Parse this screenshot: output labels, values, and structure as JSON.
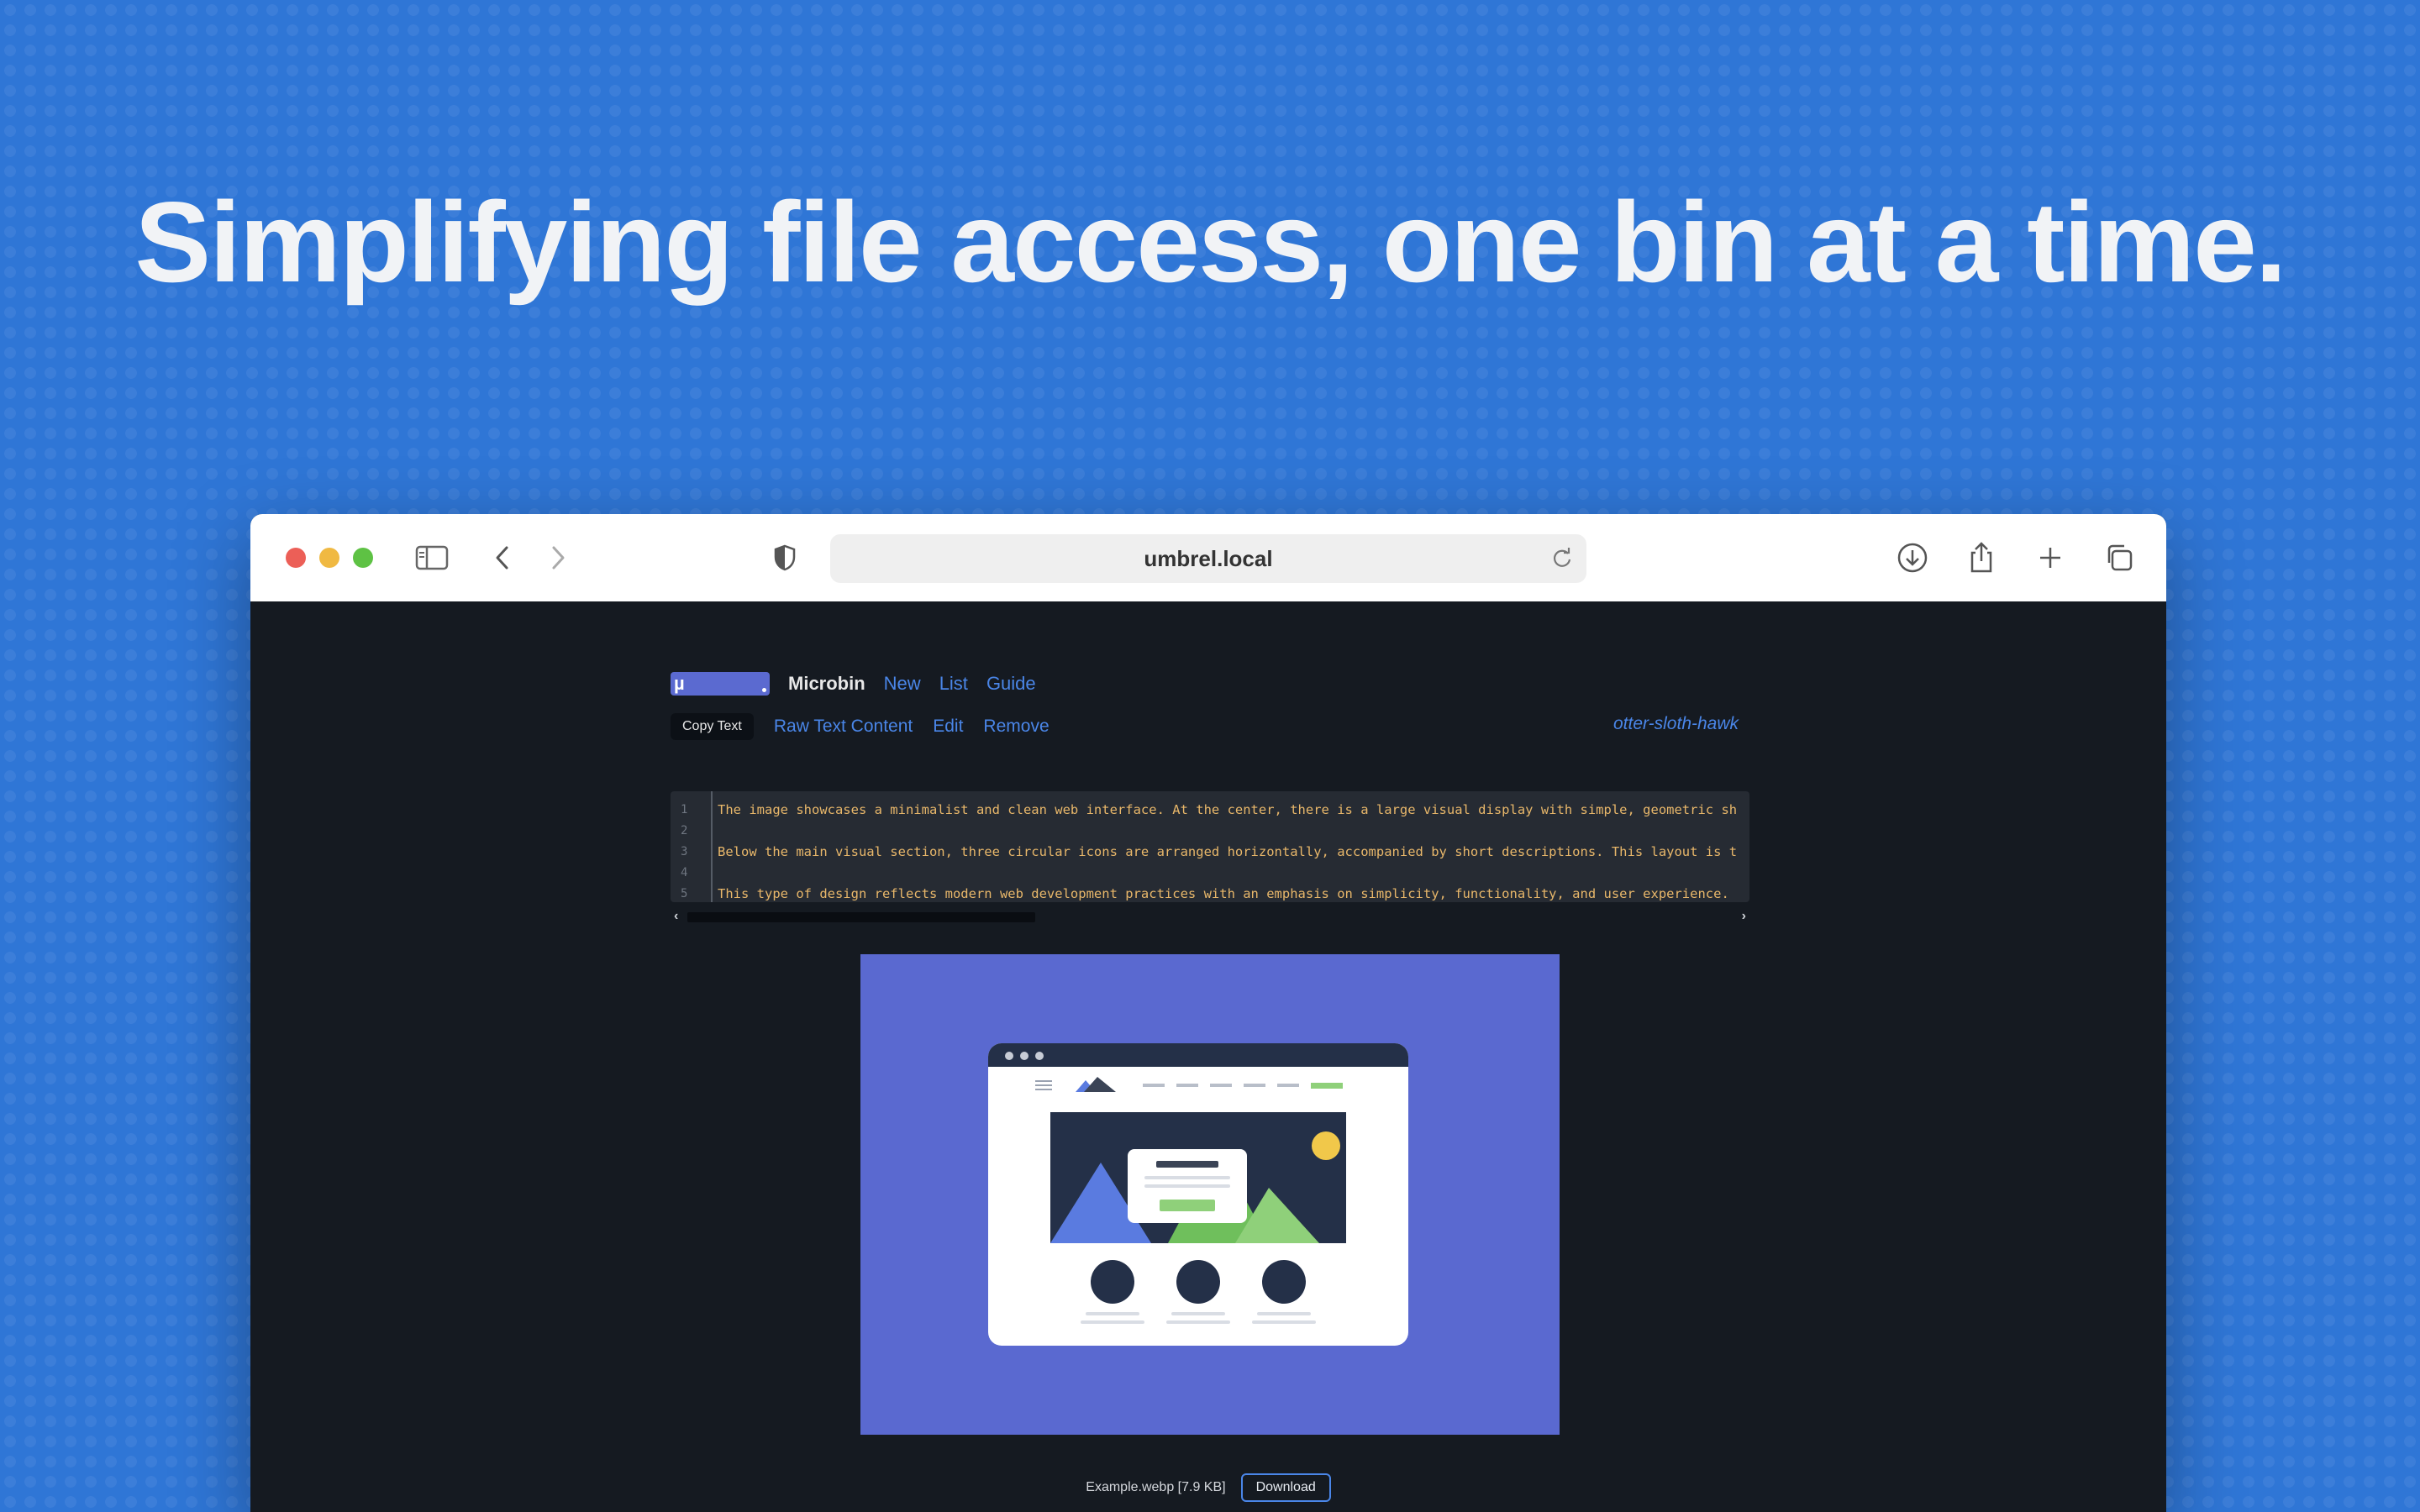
{
  "headline": "Simplifying file access, one bin at a time.",
  "browser": {
    "url": "umbrel.local",
    "icons": [
      "sidebar-icon",
      "back-icon",
      "forward-icon",
      "shield-icon",
      "reload-icon",
      "download-icon",
      "share-icon",
      "new-tab-icon",
      "tabs-overview-icon"
    ]
  },
  "app": {
    "logo_text": "µ",
    "name": "Microbin",
    "nav": [
      "New",
      "List",
      "Guide"
    ],
    "actions": {
      "copy": "Copy Text",
      "raw": "Raw Text Content",
      "edit": "Edit",
      "remove": "Remove"
    },
    "slug": "otter-sloth-hawk"
  },
  "code": {
    "line_numbers": [
      "1",
      "2",
      "3",
      "4",
      "5"
    ],
    "lines": [
      "The image showcases a minimalist and clean web interface. At the center, there is a large visual display with simple, geometric sh",
      "",
      "Below the main visual section, three circular icons are arranged horizontally, accompanied by short descriptions. This layout is t",
      "",
      "This type of design reflects modern web development practices with an emphasis on simplicity, functionality, and user experience."
    ]
  },
  "file": {
    "name_size": "Example.webp [7.9 KB]",
    "download": "Download"
  },
  "colors": {
    "page_bg": "#2f76d6",
    "app_bg": "#151a21",
    "link": "#4a86e8",
    "preview_bg": "#5a69d0",
    "code_text": "#e8b76a"
  }
}
